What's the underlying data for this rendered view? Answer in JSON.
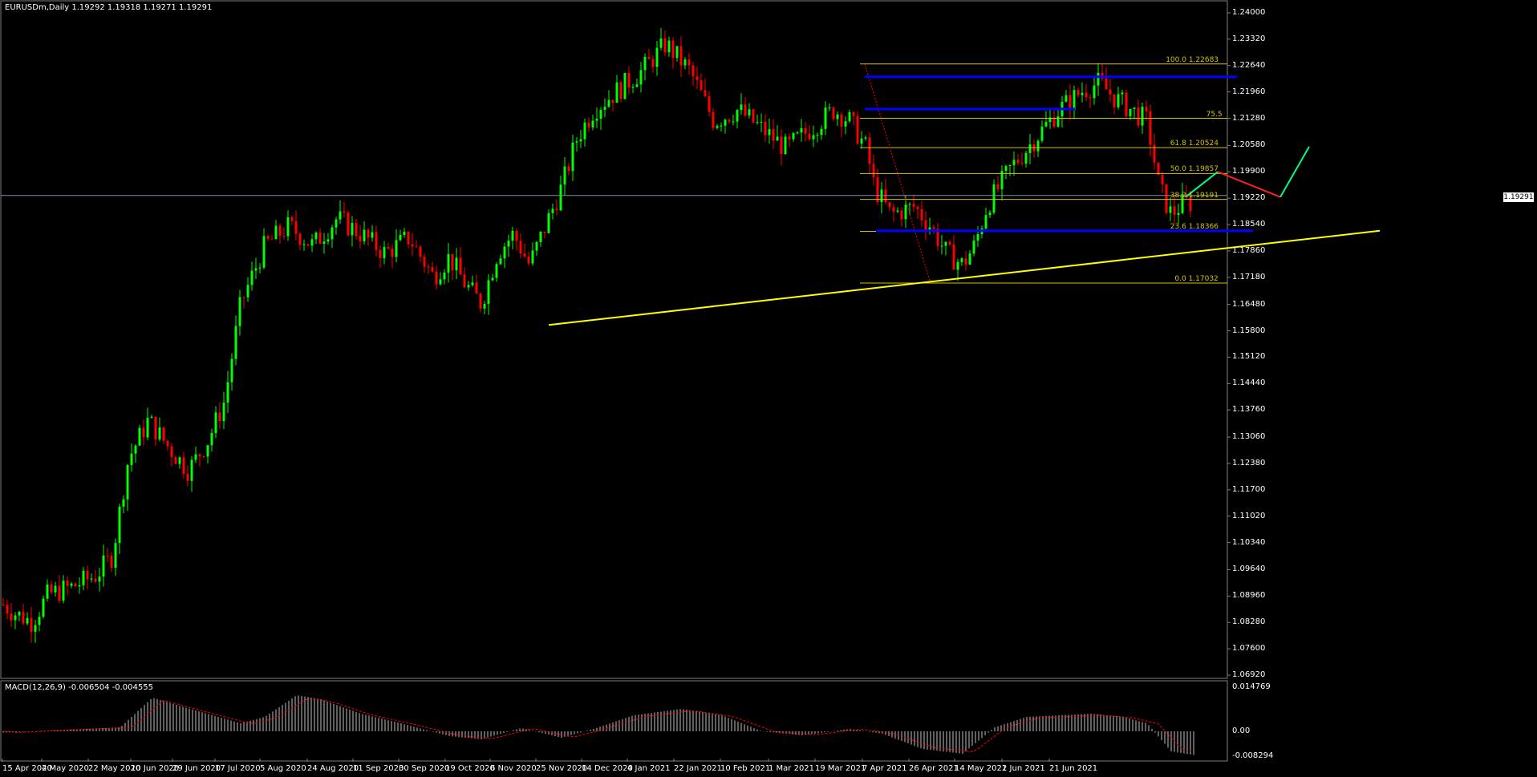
{
  "header": {
    "symbol_info": "EURUSDm,Daily  1.19292 1.19318 1.19271 1.19291"
  },
  "macd": {
    "label": "MACD(12,26,9) -0.006504 -0.004555",
    "scale_top": "0.014769",
    "scale_zero": "0.00",
    "scale_bottom": "-0.008294"
  },
  "current_price": "1.19291",
  "price_scale": [
    "1.24000",
    "1.23320",
    "1.22640",
    "1.21960",
    "1.21280",
    "1.20580",
    "1.19900",
    "1.19220",
    "1.18540",
    "1.17860",
    "1.17180",
    "1.16480",
    "1.15800",
    "1.15120",
    "1.14440",
    "1.13760",
    "1.13060",
    "1.12380",
    "1.11700",
    "1.11020",
    "1.10340",
    "1.09640",
    "1.08960",
    "1.08280",
    "1.07600",
    "1.06920"
  ],
  "date_scale": [
    "15 Apr 2020",
    "4 May 2020",
    "22 May 2020",
    "10 Jun 2020",
    "29 Jun 2020",
    "17 Jul 2020",
    "5 Aug 2020",
    "24 Aug 2020",
    "11 Sep 2020",
    "30 Sep 2020",
    "19 Oct 2020",
    "6 Nov 2020",
    "25 Nov 2020",
    "14 Dec 2020",
    "4 Jan 2021",
    "22 Jan 2021",
    "10 Feb 2021",
    "1 Mar 2021",
    "19 Mar 2021",
    "7 Apr 2021",
    "26 Apr 2021",
    "14 May 2021",
    "2 Jun 2021",
    "21 Jun 2021"
  ],
  "fib_labels": [
    {
      "text": "100.0 1.22683",
      "price": 1.22683
    },
    {
      "text": "75.5",
      "price": 1.2128
    },
    {
      "text": "61.8 1.20524",
      "price": 1.20524
    },
    {
      "text": "50.0 1.19857",
      "price": 1.19857
    },
    {
      "text": "38.2 1.19191",
      "price": 1.19191
    },
    {
      "text": "23.6 1.18366",
      "price": 1.18366
    },
    {
      "text": "0.0 1.17032",
      "price": 1.17032
    }
  ],
  "colors": {
    "bull": "#00ff00",
    "bear": "#ff0000",
    "fib": "#d4c400",
    "trend": "#ffff00",
    "support": "#0000ff",
    "forecast_up": "#00ff80",
    "forecast_down": "#ff2020",
    "macd_hist": "#c0c0c0",
    "macd_signal": "#ff0000"
  }
}
